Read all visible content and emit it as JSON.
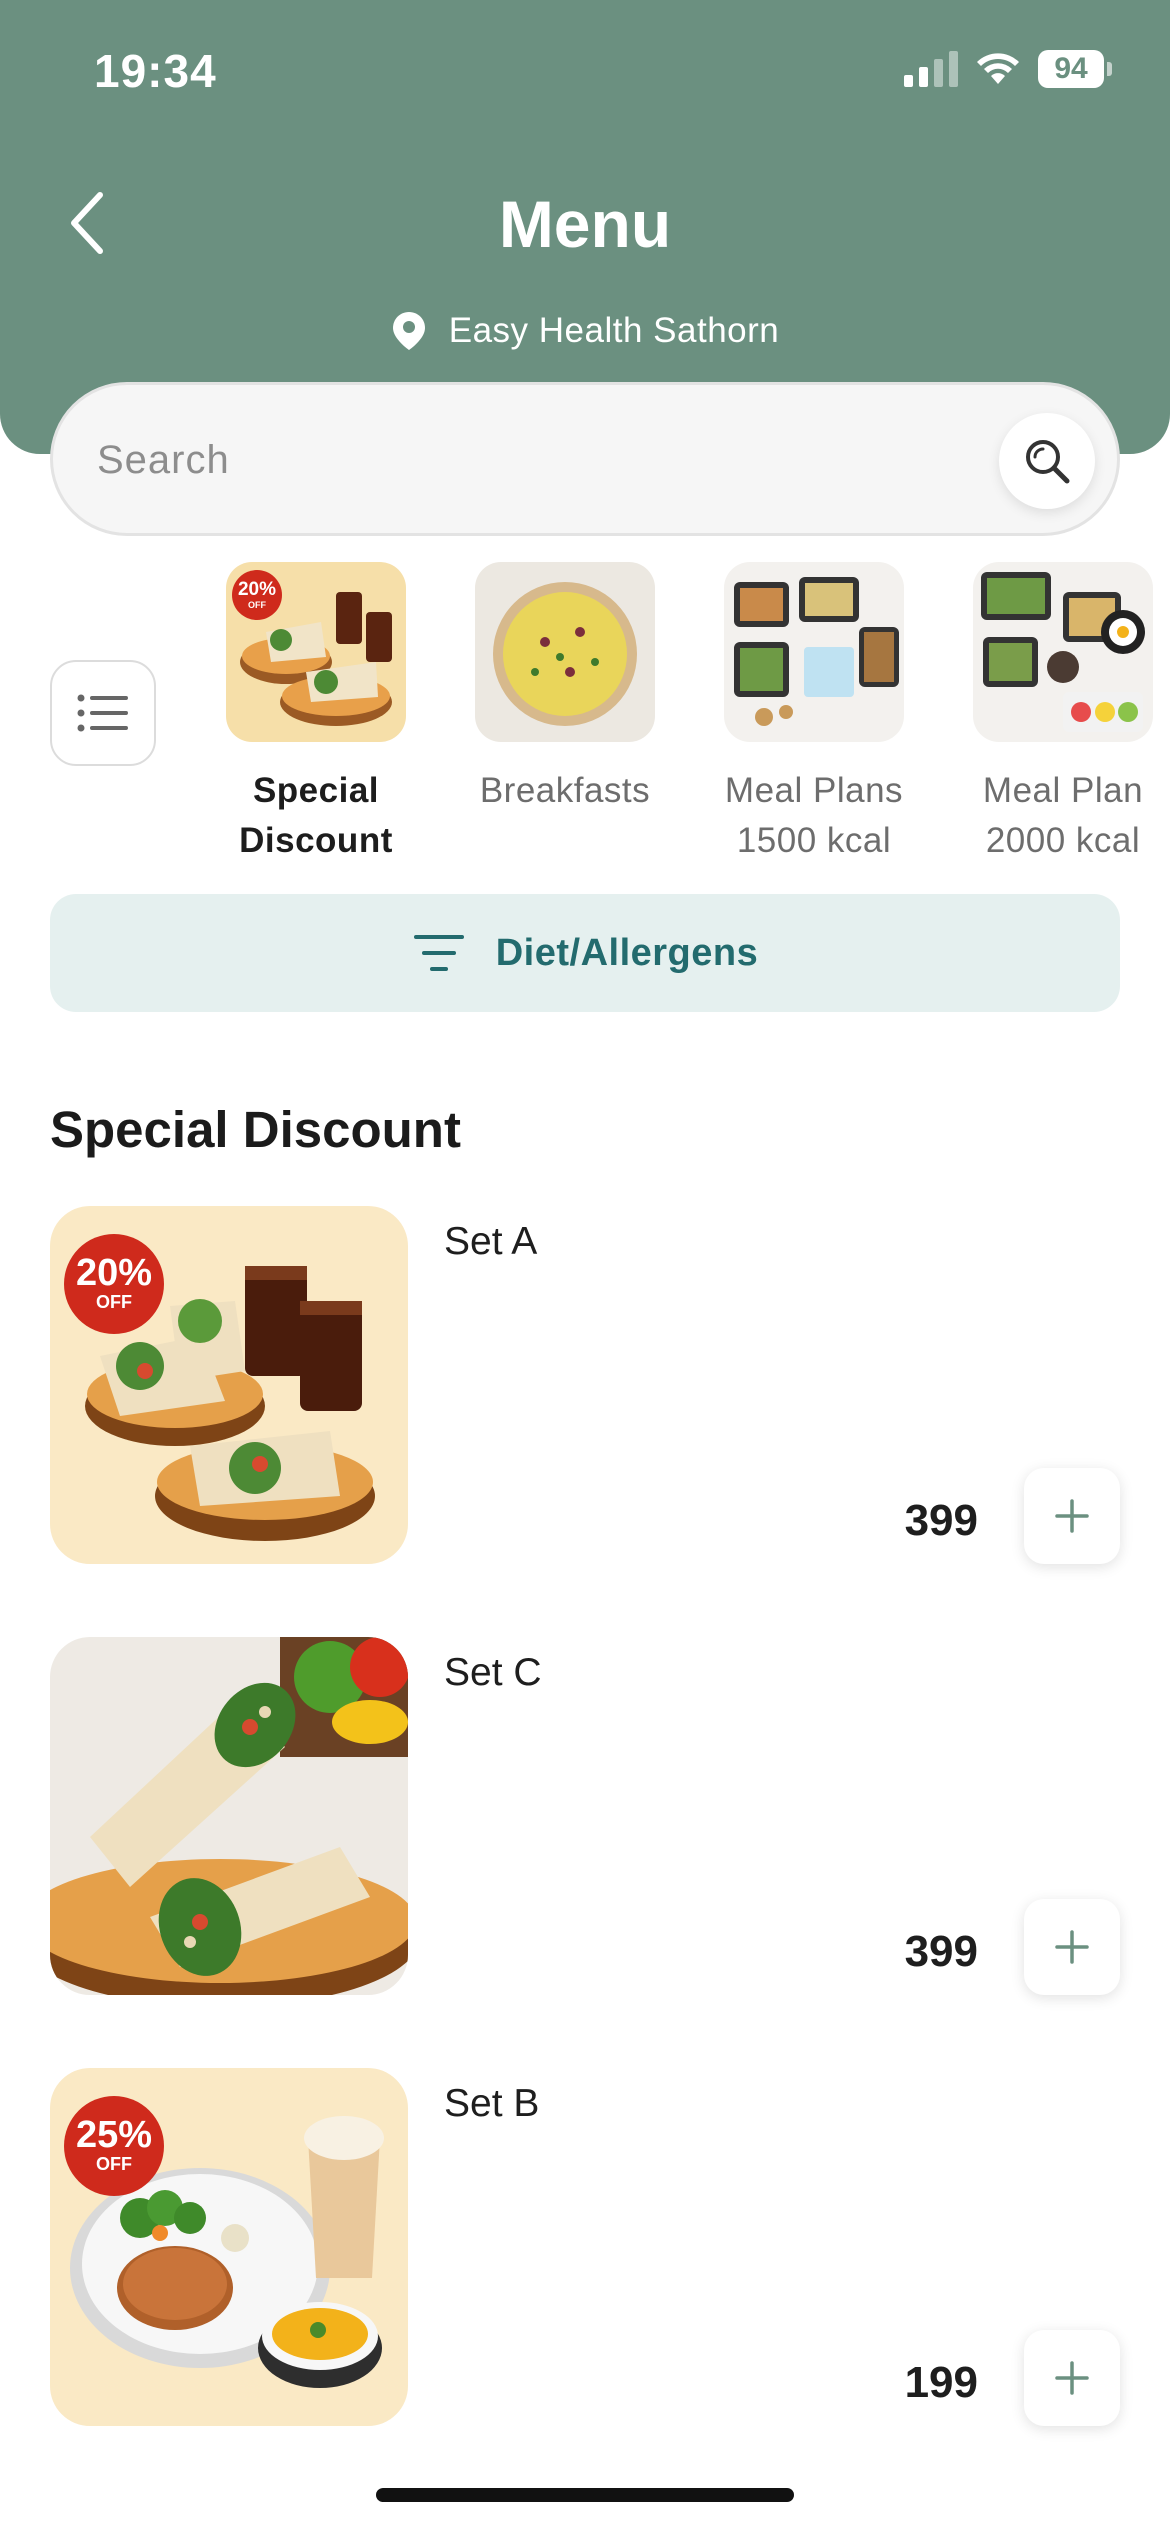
{
  "status_bar": {
    "time": "19:34",
    "battery": "94"
  },
  "header": {
    "title": "Menu",
    "location": "Easy Health Sathorn"
  },
  "search": {
    "placeholder": "Search"
  },
  "categories": [
    {
      "line1": "Special",
      "line2": "Discount",
      "active": true
    },
    {
      "line1": "Breakfasts",
      "line2": "",
      "active": false
    },
    {
      "line1": "Meal Plans",
      "line2": "1500 kcal",
      "active": false
    },
    {
      "line1": "Meal Plan",
      "line2": "2000 kcal",
      "active": false
    }
  ],
  "category_badge": "20%",
  "filter": {
    "label": "Diet/Allergens"
  },
  "section": {
    "title": "Special Discount"
  },
  "items": [
    {
      "name": "Set A",
      "price": "399",
      "badge_pct": "20%",
      "badge_off": "OFF"
    },
    {
      "name": "Set C",
      "price": "399"
    },
    {
      "name": "Set B",
      "price": "199",
      "badge_pct": "25%",
      "badge_off": "OFF"
    }
  ],
  "colors": {
    "header": "#6b9080",
    "accent": "#236b6e",
    "badge": "#cf2a1c",
    "filter_bg": "#e5f0ef"
  }
}
